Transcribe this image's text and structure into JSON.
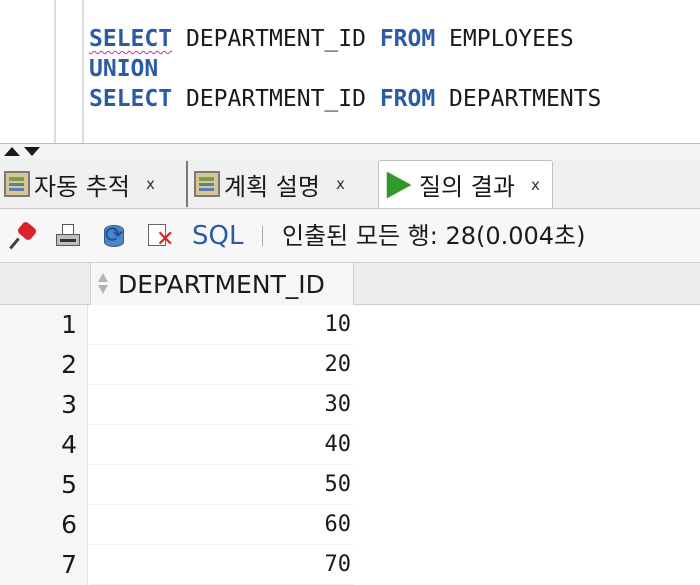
{
  "editor": {
    "lines": [
      [
        {
          "t": "SELECT",
          "kw": true,
          "squiggle": true
        },
        {
          "t": " DEPARTMENT_ID "
        },
        {
          "t": "FROM",
          "kw": true
        },
        {
          "t": " EMPLOYEES"
        }
      ],
      [
        {
          "t": "UNION",
          "kw": true
        }
      ],
      [
        {
          "t": "SELECT",
          "kw": true
        },
        {
          "t": " DEPARTMENT_ID "
        },
        {
          "t": "FROM",
          "kw": true
        },
        {
          "t": " DEPARTMENTS"
        }
      ]
    ]
  },
  "tabs": [
    {
      "label": "자동 추적",
      "icon": "autotrace-icon",
      "close": "x",
      "active": false
    },
    {
      "label": "계획 설명",
      "icon": "explain-plan-icon",
      "close": "x",
      "active": false
    },
    {
      "label": "질의 결과",
      "icon": "run-icon",
      "close": "x",
      "active": true
    }
  ],
  "toolbar": {
    "sql_label": "SQL",
    "status": "인출된 모든 행: 28(0.004초)"
  },
  "results": {
    "columns": [
      "DEPARTMENT_ID"
    ],
    "rows": [
      {
        "num": "1",
        "value": "10"
      },
      {
        "num": "2",
        "value": "20"
      },
      {
        "num": "3",
        "value": "30"
      },
      {
        "num": "4",
        "value": "40"
      },
      {
        "num": "5",
        "value": "50"
      },
      {
        "num": "6",
        "value": "60"
      },
      {
        "num": "7",
        "value": "70"
      }
    ]
  },
  "colors": {
    "keyword": "#2b5aa8",
    "run_green": "#2f9a28",
    "squiggle": "#d0309a"
  }
}
